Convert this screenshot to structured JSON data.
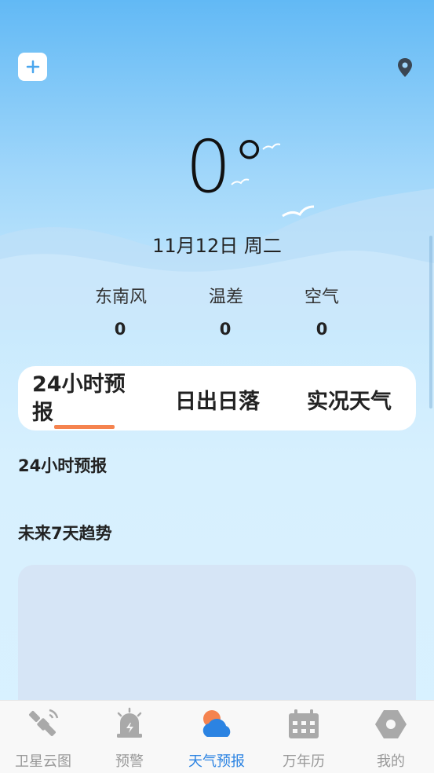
{
  "header": {
    "add_icon": "plus-icon",
    "location_icon": "location-pin-icon"
  },
  "weather": {
    "temperature": "0°",
    "date": "11月12日  周二"
  },
  "stats": [
    {
      "label": "东南风",
      "value": "0"
    },
    {
      "label": "温差",
      "value": "0"
    },
    {
      "label": "空气",
      "value": "0"
    }
  ],
  "tabs": [
    {
      "label": "24小时预报",
      "active": true
    },
    {
      "label": "日出日落",
      "active": false
    },
    {
      "label": "实况天气",
      "active": false
    }
  ],
  "sections": {
    "hourly_title": "24小时预报",
    "trend_title": "未来7天趋势"
  },
  "bottom_nav": [
    {
      "label": "卫星云图",
      "icon": "satellite-icon",
      "active": false
    },
    {
      "label": "预警",
      "icon": "alarm-light-icon",
      "active": false
    },
    {
      "label": "天气预报",
      "icon": "cloud-sun-icon",
      "active": true
    },
    {
      "label": "万年历",
      "icon": "calendar-icon",
      "active": false
    },
    {
      "label": "我的",
      "icon": "profile-hexagon-icon",
      "active": false
    }
  ],
  "colors": {
    "accent": "#2b83e2",
    "tab_underline": "#f5834f",
    "nav_inactive": "#999999"
  }
}
